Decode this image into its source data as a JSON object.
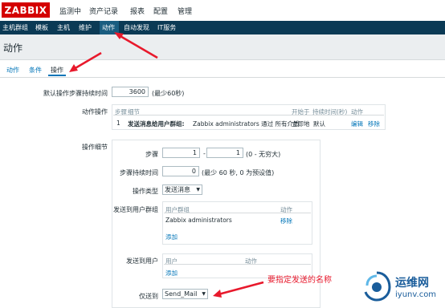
{
  "logo": "ZABBIX",
  "top_nav": [
    "监测中",
    "资产记录",
    "报表",
    "配置",
    "管理"
  ],
  "sub_nav": [
    "主机群组",
    "模板",
    "主机",
    "维护",
    "动作",
    "自动发现",
    "IT服务"
  ],
  "page_title": "动作",
  "tabs": [
    "动作",
    "条件",
    "操作"
  ],
  "form": {
    "default_duration_label": "默认操作步骤持续时间",
    "default_duration_value": "3600",
    "default_duration_hint": "(最少60秒)",
    "ops_label": "动作操作",
    "ops_table": {
      "headers": [
        "步骤",
        "细节",
        "开始于",
        "持续时间(秒)",
        "动作"
      ],
      "row": {
        "step": "1",
        "detail_bold": "发送消息给用户群组:",
        "detail_rest": "Zabbix administrators 通过 所有介质",
        "start": "立即地",
        "duration": "默认",
        "edit": "编辑",
        "remove": "移除"
      }
    },
    "details_label": "操作细节",
    "step_label": "步骤",
    "step_from": "1",
    "step_sep": "-",
    "step_to": "1",
    "step_hint": "(0 - 无穷大)",
    "step_duration_label": "步骤持续时间",
    "step_duration_value": "0",
    "step_duration_hint": "(最少 60 秒, 0 为预设值)",
    "op_type_label": "操作类型",
    "op_type_value": "发送消息",
    "send_group_label": "发送到用户群组",
    "group_table": {
      "headers": [
        "用户群组",
        "动作"
      ],
      "row_name": "Zabbix administrators",
      "row_action": "移除",
      "add": "添加"
    },
    "send_user_label": "发送到用户",
    "user_table": {
      "headers": [
        "用户",
        "动作"
      ],
      "add": "添加"
    },
    "only_to_label": "仅送到",
    "only_to_value": "Send_Mail"
  },
  "annotation": "要指定发送的名称",
  "watermark": {
    "title": "运维网",
    "url": "iyunv.com"
  },
  "colors": {
    "logo_red": "#d40000",
    "subnav_bg": "#0b3a55",
    "link_blue": "#0275b8",
    "annotation_red": "#e8192c"
  }
}
